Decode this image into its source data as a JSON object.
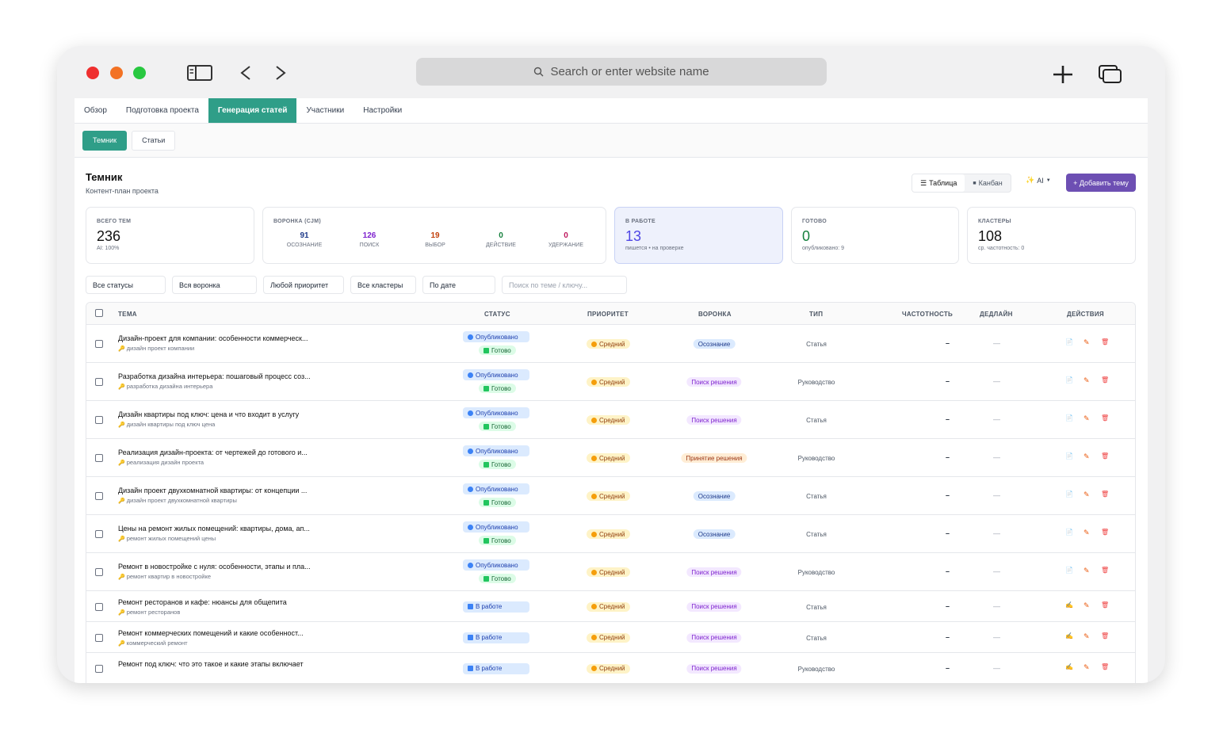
{
  "browser": {
    "address_placeholder": "Search or enter website name"
  },
  "tabs": [
    "Обзор",
    "Подготовка проекта",
    "Генерация статей",
    "Участники",
    "Настройки"
  ],
  "subtabs": [
    "Темник",
    "Статьи"
  ],
  "page": {
    "title": "Темник",
    "subtitle": "Контент-план проекта"
  },
  "view_toggle": {
    "table": "Таблица",
    "kanban": "Канбан"
  },
  "ai_label": "AI",
  "add_button": "+ Добавить тему",
  "stats": {
    "total": {
      "label": "ВСЕГО ТЕМ",
      "value": "236",
      "sub": "AI: 100%"
    },
    "funnel": {
      "label": "ВОРОНКА (CJM)",
      "items": [
        {
          "value": "91",
          "label": "ОСОЗНАНИЕ",
          "color": "#1e3a8a"
        },
        {
          "value": "126",
          "label": "ПОИСК",
          "color": "#7e22ce"
        },
        {
          "value": "19",
          "label": "ВЫБОР",
          "color": "#c2410c"
        },
        {
          "value": "0",
          "label": "ДЕЙСТВИЕ",
          "color": "#15803d"
        },
        {
          "value": "0",
          "label": "УДЕРЖАНИЕ",
          "color": "#be185d"
        }
      ]
    },
    "in_work": {
      "label": "В РАБОТЕ",
      "value": "13",
      "sub": "пишется • на проверке"
    },
    "done": {
      "label": "ГОТОВО",
      "value": "0",
      "sub": "опубликовано: 9"
    },
    "clusters": {
      "label": "КЛАСТЕРЫ",
      "value": "108",
      "sub": "ср. частотность: 0"
    }
  },
  "filters": {
    "status": "Все статусы",
    "funnel": "Вся воронка",
    "priority": "Любой приоритет",
    "clusters": "Все кластеры",
    "sort": "По дате",
    "search_placeholder": "Поиск по теме / ключу..."
  },
  "table": {
    "headers": {
      "topic": "ТЕМА",
      "status": "СТАТУС",
      "priority": "ПРИОРИТЕТ",
      "funnel": "ВОРОНКА",
      "type": "ТИП",
      "frequency": "ЧАСТОТНОСТЬ",
      "deadline": "ДЕДЛАЙН",
      "actions": "ДЕЙСТВИЯ"
    },
    "rows": [
      {
        "topic": "Дизайн-проект для компании: особенности коммерческ...",
        "keyword": "дизайн проект компании",
        "status": "Опубликовано",
        "substatus": "Готово",
        "priority": "Средний",
        "funnel": "Осознание",
        "funnel_kind": "aw",
        "type": "Статья",
        "frequency": "–",
        "deadline": "—"
      },
      {
        "topic": "Разработка дизайна интерьера: пошаговый процесс соз...",
        "keyword": "разработка дизайна интерьера",
        "status": "Опубликовано",
        "substatus": "Готово",
        "priority": "Средний",
        "funnel": "Поиск решения",
        "funnel_kind": "search",
        "type": "Руководство",
        "frequency": "–",
        "deadline": "—"
      },
      {
        "topic": "Дизайн квартиры под ключ: цена и что входит в услугу",
        "keyword": "дизайн квартиры под ключ цена",
        "status": "Опубликовано",
        "substatus": "Готово",
        "priority": "Средний",
        "funnel": "Поиск решения",
        "funnel_kind": "search",
        "type": "Статья",
        "frequency": "–",
        "deadline": "—"
      },
      {
        "topic": "Реализация дизайн-проекта: от чертежей до готового и...",
        "keyword": "реализация дизайн проекта",
        "status": "Опубликовано",
        "substatus": "Готово",
        "priority": "Средний",
        "funnel": "Принятие решения",
        "funnel_kind": "dec",
        "type": "Руководство",
        "frequency": "–",
        "deadline": "—"
      },
      {
        "topic": "Дизайн проект двухкомнатной квартиры: от концепции ...",
        "keyword": "дизайн проект двухкомнатной квартиры",
        "status": "Опубликовано",
        "substatus": "Готово",
        "priority": "Средний",
        "funnel": "Осознание",
        "funnel_kind": "aw",
        "type": "Статья",
        "frequency": "–",
        "deadline": "—"
      },
      {
        "topic": "Цены на ремонт жилых помещений: квартиры, дома, ап...",
        "keyword": "ремонт жилых помещений цены",
        "status": "Опубликовано",
        "substatus": "Готово",
        "priority": "Средний",
        "funnel": "Осознание",
        "funnel_kind": "aw",
        "type": "Статья",
        "frequency": "–",
        "deadline": "—"
      },
      {
        "topic": "Ремонт в новостройке с нуля: особенности, этапы и пла...",
        "keyword": "ремонт квартир в новостройке",
        "status": "Опубликовано",
        "substatus": "Готово",
        "priority": "Средний",
        "funnel": "Поиск решения",
        "funnel_kind": "search",
        "type": "Руководство",
        "frequency": "–",
        "deadline": "—"
      },
      {
        "topic": "Ремонт ресторанов и кафе: нюансы для общепита",
        "keyword": "ремонт ресторанов",
        "status": "В работе",
        "substatus": "",
        "priority": "Средний",
        "funnel": "Поиск решения",
        "funnel_kind": "search",
        "type": "Статья",
        "frequency": "–",
        "deadline": "—"
      },
      {
        "topic": "Ремонт коммерческих помещений и какие особенност...",
        "keyword": "коммерческий ремонт",
        "status": "В работе",
        "substatus": "",
        "priority": "Средний",
        "funnel": "Поиск решения",
        "funnel_kind": "search",
        "type": "Статья",
        "frequency": "–",
        "deadline": "—"
      },
      {
        "topic": "Ремонт под ключ: что это такое и какие этапы включает",
        "keyword": "",
        "status": "В работе",
        "substatus": "",
        "priority": "Средний",
        "funnel": "Поиск решения",
        "funnel_kind": "search",
        "type": "Руководство",
        "frequency": "–",
        "deadline": "—"
      }
    ]
  }
}
